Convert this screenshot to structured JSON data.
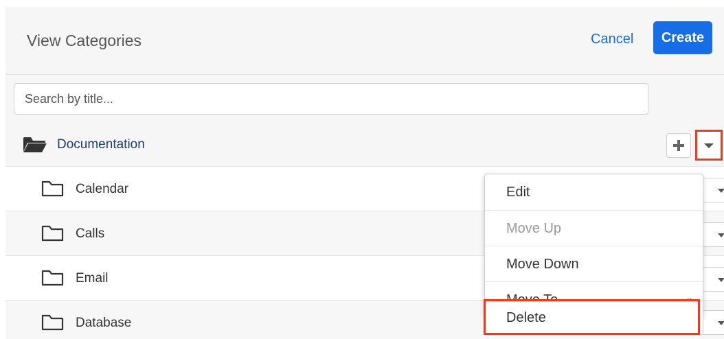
{
  "header": {
    "title": "View Categories",
    "cancel_label": "Cancel",
    "create_label": "Create"
  },
  "search": {
    "placeholder": "Search by title..."
  },
  "tree": {
    "root": {
      "label": "Documentation",
      "icon": "folder-open-icon"
    },
    "children": [
      {
        "label": "Calendar",
        "icon": "folder-icon"
      },
      {
        "label": "Calls",
        "icon": "folder-icon"
      },
      {
        "label": "Email",
        "icon": "folder-icon"
      },
      {
        "label": "Database",
        "icon": "folder-icon"
      }
    ]
  },
  "actions_menu": {
    "items": [
      {
        "label": "Edit",
        "enabled": true
      },
      {
        "label": "Move Up",
        "enabled": false
      },
      {
        "label": "Move Down",
        "enabled": true
      },
      {
        "label": "Move To",
        "enabled": true,
        "submenu_indicator": "»"
      },
      {
        "label": "Delete",
        "enabled": true,
        "highlighted": true
      }
    ]
  },
  "colors": {
    "accent": "#176de5",
    "highlight_box": "#f03a1c",
    "root_label": "#1f3c6d"
  }
}
